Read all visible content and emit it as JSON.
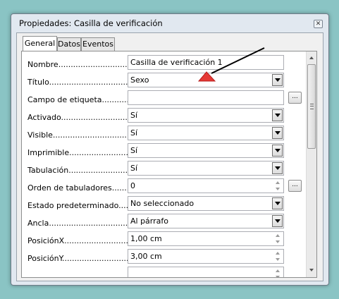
{
  "window": {
    "title": "Propiedades: Casilla de verificación",
    "close_icon": "close-icon"
  },
  "tabs": [
    {
      "label": "General",
      "active": true
    },
    {
      "label": "Datos",
      "active": false
    },
    {
      "label": "Eventos",
      "active": false
    }
  ],
  "properties": [
    {
      "label": "Nombre.................................",
      "value": "Casilla de verificación 1",
      "control": "text"
    },
    {
      "label": "Título......................................",
      "value": "Sexo",
      "control": "dropdown"
    },
    {
      "label": "Campo de etiqueta............",
      "value": "",
      "control": "text-button"
    },
    {
      "label": "Activado...............................",
      "value": "Sí",
      "control": "dropdown"
    },
    {
      "label": "Visible....................................",
      "value": "Sí",
      "control": "dropdown"
    },
    {
      "label": "Imprimible............................",
      "value": "Sí",
      "control": "dropdown"
    },
    {
      "label": "Tabulación...........................",
      "value": "Sí",
      "control": "dropdown"
    },
    {
      "label": "Orden de tabuladores.......",
      "value": "0",
      "control": "spin-button"
    },
    {
      "label": "Estado predeterminado.....",
      "value": "No seleccionado",
      "control": "dropdown"
    },
    {
      "label": "Ancla......................................",
      "value": "Al párrafo",
      "control": "dropdown"
    },
    {
      "label": "PosiciónX............................",
      "value": "1,00 cm",
      "control": "spin"
    },
    {
      "label": "PosiciónY............................",
      "value": "3,00 cm",
      "control": "spin"
    },
    {
      "label": "",
      "value": "",
      "control": "spin"
    }
  ],
  "ellipsis_label": "...",
  "annotation": {
    "arrow_color": "#000000",
    "marker_color": "#e53935"
  }
}
